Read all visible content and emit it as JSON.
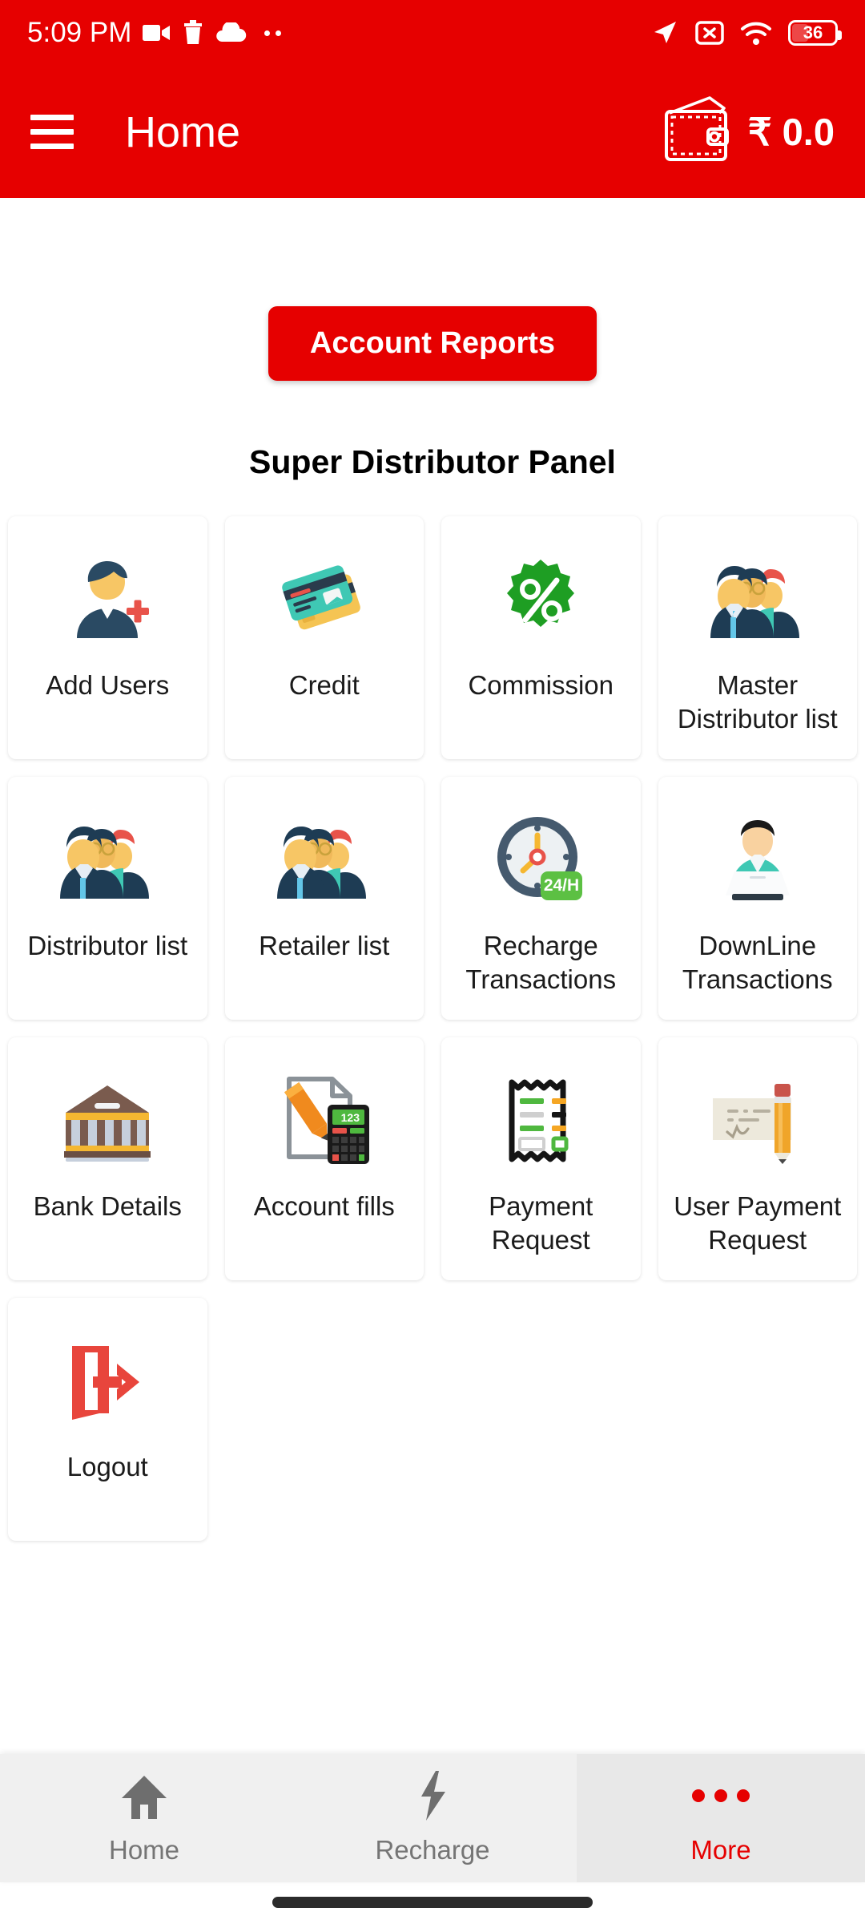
{
  "status_bar": {
    "time": "5:09 PM",
    "left_icons": [
      "video-camera-icon",
      "trash-icon",
      "cloud-icon",
      "overflow-dots-icon"
    ],
    "right_icons": [
      "location-arrow-icon",
      "sim-card-disabled-icon",
      "wifi-icon"
    ],
    "battery_percent": "36"
  },
  "app_bar": {
    "menu_icon": "hamburger-menu-icon",
    "title": "Home",
    "wallet_icon": "wallet-icon",
    "balance": "₹ 0.0"
  },
  "main": {
    "account_reports_label": "Account Reports",
    "panel_title": "Super Distributor Panel",
    "tiles": [
      {
        "label": "Add Users",
        "icon": "add-user-icon"
      },
      {
        "label": "Credit",
        "icon": "credit-cards-icon"
      },
      {
        "label": "Commission",
        "icon": "percent-badge-icon"
      },
      {
        "label": "Master Distributor list",
        "icon": "people-group-icon"
      },
      {
        "label": "Distributor list",
        "icon": "people-group-icon"
      },
      {
        "label": "Retailer list",
        "icon": "people-group-icon"
      },
      {
        "label": "Recharge Transactions",
        "icon": "clock-24h-icon"
      },
      {
        "label": "DownLine Transactions",
        "icon": "person-laptop-icon"
      },
      {
        "label": "Bank Details",
        "icon": "bank-building-icon"
      },
      {
        "label": "Account fills",
        "icon": "document-calculator-icon"
      },
      {
        "label": "Payment Request",
        "icon": "receipt-icon"
      },
      {
        "label": "User Payment Request",
        "icon": "cheque-pencil-icon"
      },
      {
        "label": "Logout",
        "icon": "logout-door-icon"
      }
    ]
  },
  "bottom_nav": {
    "items": [
      {
        "label": "Home",
        "icon": "home-icon",
        "active": false
      },
      {
        "label": "Recharge",
        "icon": "lightning-icon",
        "active": false
      },
      {
        "label": "More",
        "icon": "more-dots-icon",
        "active": true
      }
    ]
  },
  "colors": {
    "brand_red": "#E60000",
    "accent_red": "#E8281E",
    "nav_inactive": "#757575",
    "nav_bg": "#F0F0F0"
  }
}
